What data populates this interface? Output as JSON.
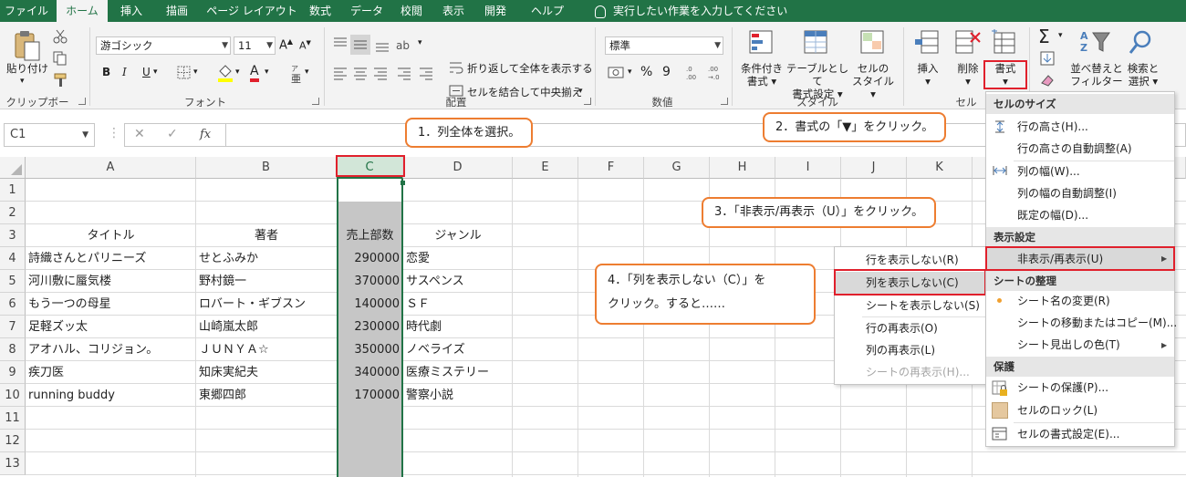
{
  "tabs": [
    {
      "label": "ファイル",
      "active": false
    },
    {
      "label": "ホーム",
      "active": true
    },
    {
      "label": "挿入",
      "active": false
    },
    {
      "label": "描画",
      "active": false
    },
    {
      "label": "ページ レイアウト",
      "active": false
    },
    {
      "label": "数式",
      "active": false
    },
    {
      "label": "データ",
      "active": false
    },
    {
      "label": "校閲",
      "active": false
    },
    {
      "label": "表示",
      "active": false
    },
    {
      "label": "開発",
      "active": false
    },
    {
      "label": "ヘルプ",
      "active": false
    }
  ],
  "tell_me": "実行したい作業を入力してください",
  "ribbon": {
    "clipboard": {
      "paste": "貼り付け",
      "group": "クリップボード"
    },
    "font": {
      "name": "游ゴシック",
      "size": "11",
      "bold": "B",
      "italic": "I",
      "underline": "U",
      "grow": "A",
      "shrink": "A",
      "color_a": "A",
      "group": "フォント"
    },
    "alignment": {
      "wrap": "折り返して全体を表示する",
      "merge": "セルを結合して中央揃え",
      "group": "配置"
    },
    "number": {
      "format": "標準",
      "percent": "%",
      "comma": "9",
      "group": "数値"
    },
    "styles": {
      "conditional_1": "条件付き",
      "conditional_2": "書式",
      "table_1": "テーブルとして",
      "table_2": "書式設定",
      "cell_1": "セルの",
      "cell_2": "スタイル",
      "group": "スタイル"
    },
    "cells": {
      "insert": "挿入",
      "delete": "削除",
      "format": "書式",
      "group": "セル"
    },
    "editing": {
      "sort_1": "並べ替えと",
      "sort_2": "フィルター",
      "find_1": "検索と",
      "find_2": "選択"
    }
  },
  "formula_bar": {
    "name_box": "C1",
    "fx": "fx",
    "content": ""
  },
  "columns": [
    "A",
    "B",
    "C",
    "D",
    "E",
    "F",
    "G",
    "H",
    "I",
    "J",
    "K"
  ],
  "rows": [
    "1",
    "2",
    "3",
    "4",
    "5",
    "6",
    "7",
    "8",
    "9",
    "10",
    "11",
    "12",
    "13"
  ],
  "headers_row": {
    "title": "タイトル",
    "author": "著者",
    "sales": "売上部数",
    "genre": "ジャンル"
  },
  "data_rows": [
    {
      "title": "詩織さんとパリニーズ",
      "author": "せとふみか",
      "sales": "290000",
      "genre": "恋愛"
    },
    {
      "title": "河川敷に蜃気楼",
      "author": "野村鏡一",
      "sales": "370000",
      "genre": "サスペンス"
    },
    {
      "title": "もう一つの母星",
      "author": "ロバート・ギブスン",
      "sales": "140000",
      "genre": "ＳＦ"
    },
    {
      "title": "足軽ズッ太",
      "author": "山崎嵐太郎",
      "sales": "230000",
      "genre": "時代劇"
    },
    {
      "title": "アオハル、コリジョン。",
      "author": "ＪＵＮＹＡ☆",
      "sales": "350000",
      "genre": "ノベライズ"
    },
    {
      "title": "疾刀医",
      "author": "知床実紀夫",
      "sales": "340000",
      "genre": "医療ミステリー"
    },
    {
      "title": "running buddy",
      "author": "東郷四郎",
      "sales": "170000",
      "genre": "警察小説"
    }
  ],
  "callouts": {
    "step1": "1．列全体を選択。",
    "step2": "2．書式の「▼」をクリック。",
    "step3": "3．「非表示/再表示（U）」をクリック。",
    "step4_line1": "4．「列を表示しない（C）」を",
    "step4_line2": "クリック。すると……"
  },
  "format_menu": {
    "cell_size": "セルのサイズ",
    "row_height": "行の高さ(H)...",
    "autofit_row": "行の高さの自動調整(A)",
    "col_width": "列の幅(W)...",
    "autofit_col": "列の幅の自動調整(I)",
    "default_width": "既定の幅(D)...",
    "visibility": "表示設定",
    "hide_unhide": "非表示/再表示(U)",
    "organize": "シートの整理",
    "rename": "シート名の変更(R)",
    "move_copy": "シートの移動またはコピー(M)...",
    "tab_color": "シート見出しの色(T)",
    "protection": "保護",
    "protect_sheet": "シートの保護(P)...",
    "lock_cell": "セルのロック(L)",
    "format_cells": "セルの書式設定(E)..."
  },
  "hide_submenu": {
    "hide_rows": "行を表示しない(R)",
    "hide_cols": "列を表示しない(C)",
    "hide_sheet": "シートを表示しない(S)",
    "unhide_rows": "行の再表示(O)",
    "unhide_cols": "列の再表示(L)",
    "unhide_sheet": "シートの再表示(H)..."
  },
  "colors": {
    "excel_green": "#217346",
    "callout_orange": "#ed7d31",
    "highlight_red": "#e0202c"
  }
}
